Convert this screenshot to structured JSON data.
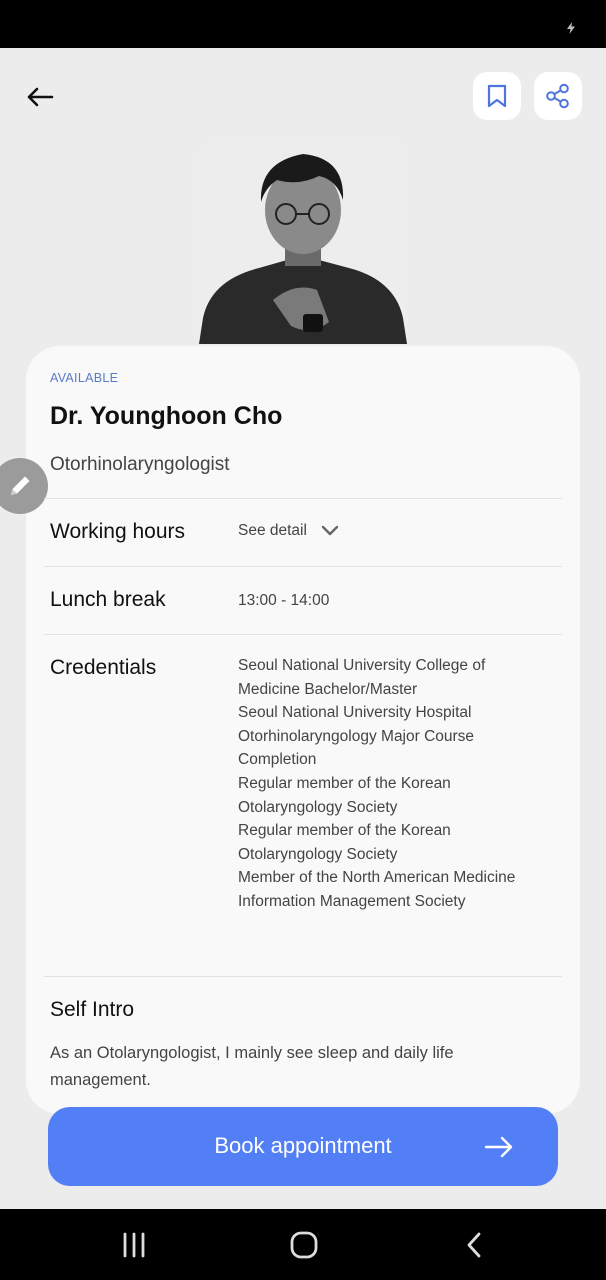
{
  "doctor": {
    "availability": "AVAILABLE",
    "name": "Dr. Younghoon Cho",
    "specialty": "Otorhinolaryngologist"
  },
  "details": {
    "working_hours": {
      "label": "Working hours",
      "value": "See detail"
    },
    "lunch_break": {
      "label": "Lunch break",
      "value": "13:00 - 14:00"
    },
    "credentials": {
      "label": "Credentials",
      "items": [
        "Seoul National University College of Medicine Bachelor/Master",
        "Seoul National University Hospital Otorhinolaryngology Major Course Completion",
        "Regular member of the Korean Otolaryngology Society",
        "Regular member of the Korean Otolaryngology Society",
        "Member of the North American Medicine Information Management Society"
      ]
    }
  },
  "intro": {
    "title": "Self Intro",
    "text": "As an Otolaryngologist, I mainly see sleep and daily life management."
  },
  "actions": {
    "book_label": "Book appointment"
  },
  "icons": {
    "back": "arrow-left-icon",
    "bookmark": "bookmark-icon",
    "share": "share-icon",
    "edit": "pencil-icon",
    "expand": "chevron-down-icon",
    "book_arrow": "arrow-right-icon"
  },
  "colors": {
    "accent": "#527ef6",
    "availability": "#5a79c6"
  }
}
